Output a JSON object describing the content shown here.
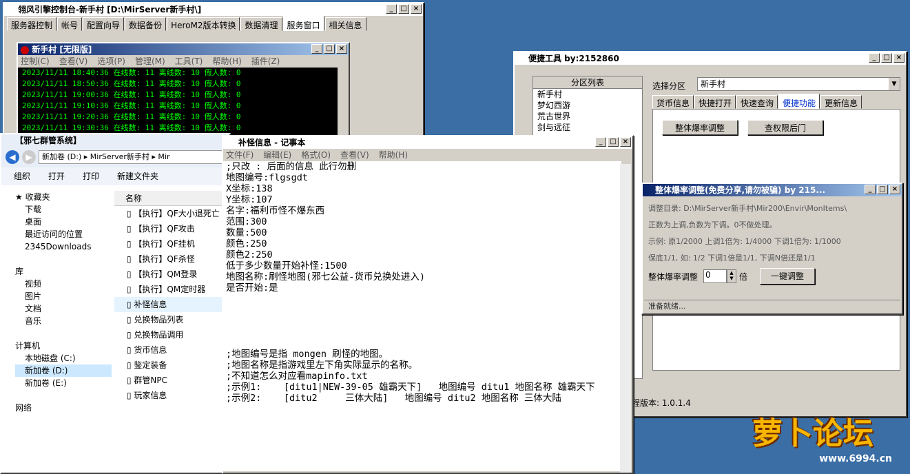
{
  "console": {
    "title": "翎风引擎控制台-新手村  [D:\\MirServer新手村\\]",
    "tabs": [
      "服务器控制",
      "帐号",
      "配置向导",
      "数据备份",
      "HeroM2版本转换",
      "数据清理",
      "服务窗口",
      "相关信息"
    ],
    "inner_title": "新手村 [无限版]",
    "menu": [
      "控制(C)",
      "查看(V)",
      "选项(P)",
      "管理(M)",
      "工具(T)",
      "帮助(H)",
      "插件(Z)"
    ],
    "logs": [
      "2023/11/11 18:40:36 在线数: 11 离线数: 10 假人数: 0",
      "2023/11/11 18:50:36 在线数: 11 离线数: 10 假人数: 0",
      "2023/11/11 19:00:36 在线数: 11 离线数: 10 假人数: 0",
      "2023/11/11 19:10:36 在线数: 11 离线数: 10 假人数: 0",
      "2023/11/11 19:20:36 在线数: 11 离线数: 10 假人数: 0",
      "2023/11/11 19:30:36 在线数: 11 离线数: 10 假人数: 0"
    ]
  },
  "explorer": {
    "title": "【邪七群管系统】",
    "path": [
      "新加卷 (D:)",
      "MirServer新手村",
      "Mir"
    ],
    "toolbar": [
      "组织",
      "打开",
      "打印",
      "新建文件夹"
    ],
    "nav": {
      "favorites": "收藏夹",
      "fav_items": [
        "下载",
        "桌面",
        "最近访问的位置",
        "2345Downloads"
      ],
      "library": "库",
      "lib_items": [
        "视频",
        "图片",
        "文档",
        "音乐"
      ],
      "computer": "计算机",
      "drives": [
        "本地磁盘 (C:)",
        "新加卷 (D:)",
        "新加卷 (E:)"
      ],
      "network": "网络"
    },
    "col_name": "名称",
    "files": [
      "【执行】QF大小退死亡",
      "【执行】QF攻击",
      "【执行】QF挂机",
      "【执行】QF杀怪",
      "【执行】QM登录",
      "【执行】QM定时器",
      "补怪信息",
      "兑换物品列表",
      "兑换物品调用",
      "货币信息",
      "鉴定装备",
      "群管NPC",
      "玩家信息"
    ]
  },
  "notepad": {
    "title": "补怪信息 - 记事本",
    "menu": [
      "文件(F)",
      "编辑(E)",
      "格式(O)",
      "查看(V)",
      "帮助(H)"
    ],
    "lines": [
      ";只改 : 后面的信息 此行勿删",
      "地图编号:flgsgdt",
      "X坐标:138",
      "Y坐标:107",
      "名字:福利币怪不爆东西",
      "范围:300",
      "数量:500",
      "颜色:250",
      "颜色2:250",
      "低于多少数量开始补怪:1500",
      "地图名称:刷怪地图(邪七公益-货币兑换处进入)",
      "是否开始:是",
      "",
      "",
      "",
      "",
      "",
      ";地图编号是指 mongen 刷怪的地图。",
      ";地图名称是指游戏里左下角实际显示的名称。",
      ";不知道怎么对应看mapinfo.txt",
      ";示例1:    [ditu1|NEW-39-05 雄霸天下]   地图编号 ditu1 地图名称 雄霸天下",
      ";示例2:    [ditu2     三体大陆]   地图编号 ditu2 地图名称 三体大陆"
    ]
  },
  "quick": {
    "title": "便捷工具   by:2152860",
    "list_header": "分区列表",
    "zones": [
      "新手村",
      "梦幻西游",
      "荒古世界",
      "剑与远征"
    ],
    "select_label": "选择分区",
    "select_value": "新手村",
    "tabs": [
      "货币信息",
      "快捷打开",
      "快速查询",
      "便捷功能",
      "更新信息"
    ],
    "btn1": "整体爆率调整",
    "btn2": "查权限后门",
    "version": "程版本: 1.0.1.4"
  },
  "drop": {
    "title": "整体爆率调整(免费分享,请勿被骗)   by 215...",
    "dir": "调整目录: D:\\MirServer新手村\\Mir200\\Envir\\MonItems\\",
    "tip1": "正数为上调,负数为下调。0不做处理。",
    "tip2": "示例: 原1/2000 上调1倍为: 1/4000 下调1倍为: 1/1000",
    "tip3": "保底1/1, 如: 1/2 下调1倍是1/1, 下调N倍还是1/1",
    "label": "整体爆率调整",
    "value": "0",
    "unit": "倍",
    "btn": "一键调整",
    "status": "准备就绪..."
  },
  "logo": {
    "text": "萝卜论坛",
    "url": "www.6994.cn"
  }
}
